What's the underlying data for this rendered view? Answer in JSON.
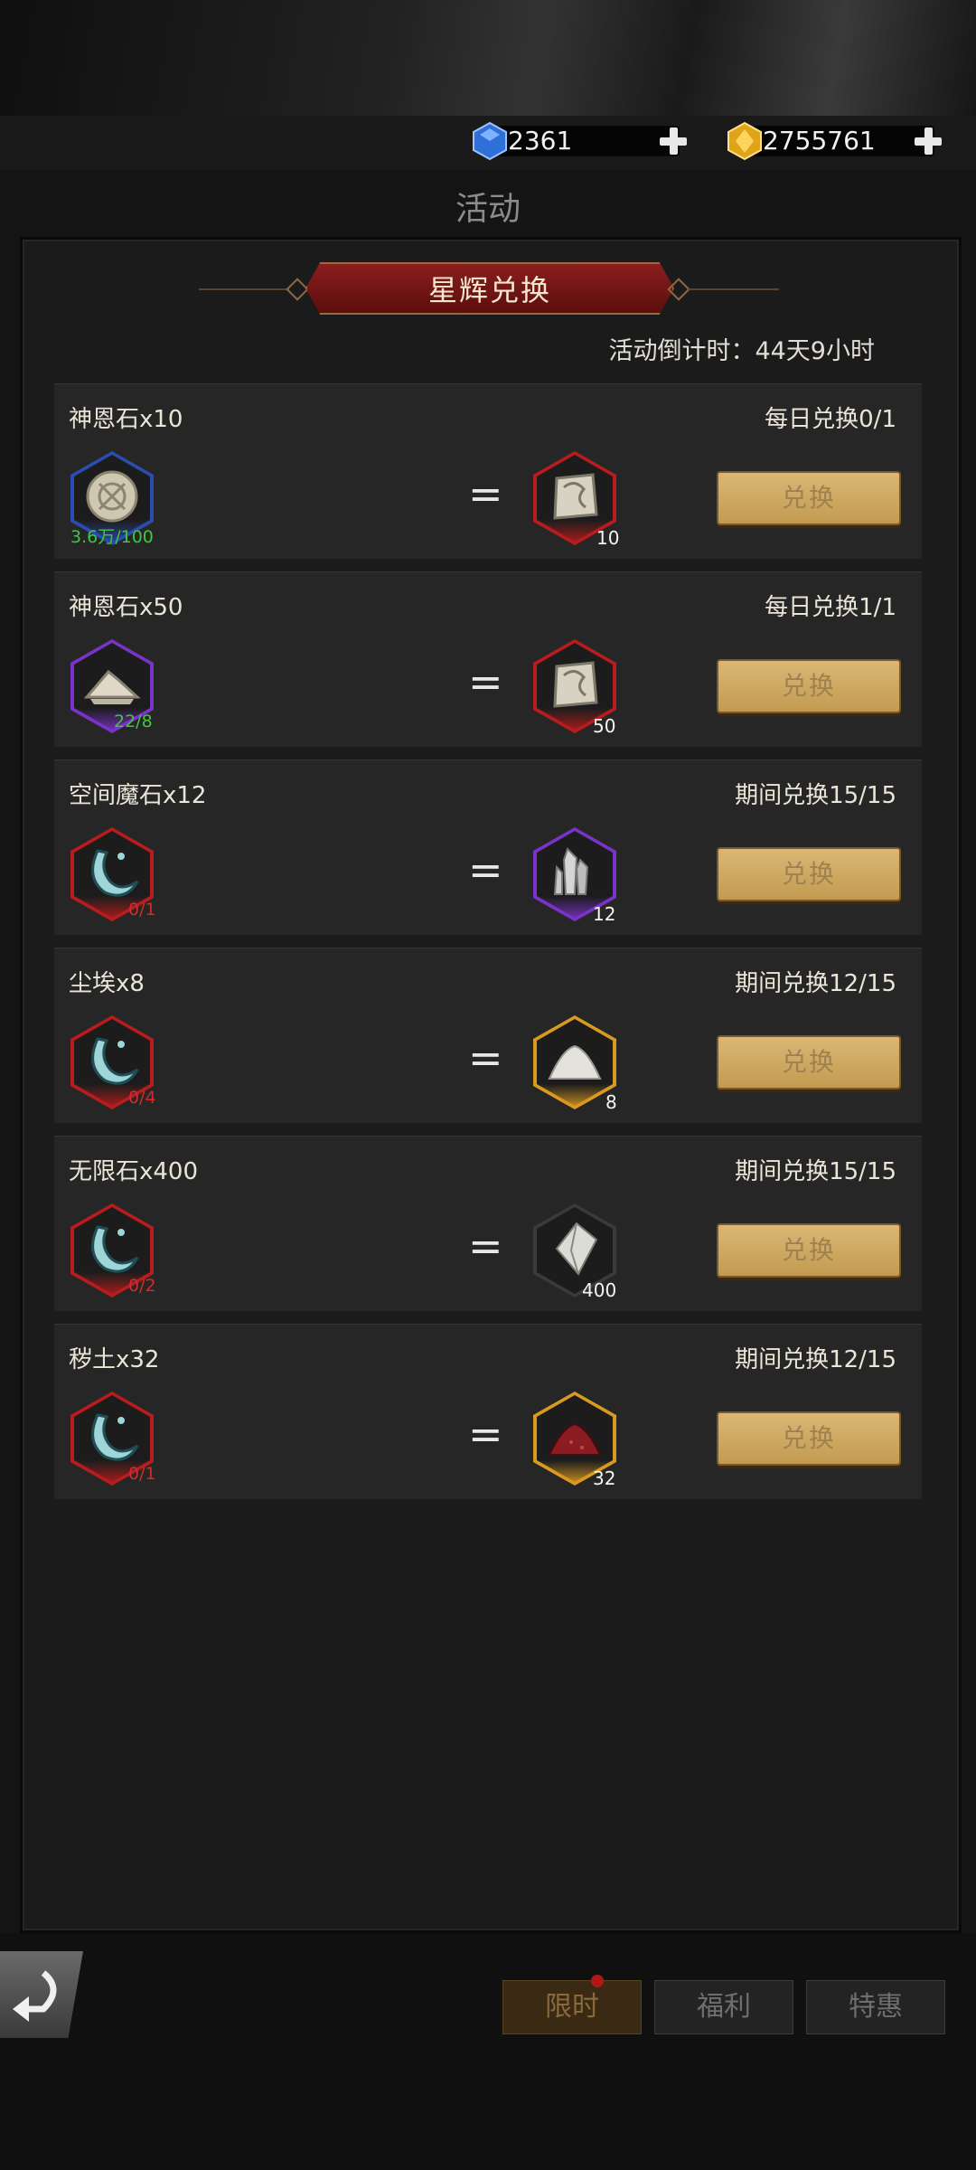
{
  "currency": [
    {
      "name": "diamond",
      "amount": "2361",
      "color": "#3d7de0"
    },
    {
      "name": "gold-gem",
      "amount": "2755761",
      "color": "#e8b020"
    }
  ],
  "header": {
    "title": "活动"
  },
  "banner": {
    "title": "星辉兑换"
  },
  "countdown": "活动倒计时：44天9小时",
  "exchanges": [
    {
      "name": "神恩石x10",
      "limit": "每日兑换0/1",
      "cost_count": "3.6万/100",
      "cost_count_color": "#3ec83e",
      "reward_count": "10",
      "button": "兑换"
    },
    {
      "name": "神恩石x50",
      "limit": "每日兑换1/1",
      "cost_count": "22/8",
      "cost_count_color": "#3ec83e",
      "reward_count": "50",
      "button": "兑换"
    },
    {
      "name": "空间魔石x12",
      "limit": "期间兑换15/15",
      "cost_count": "0/1",
      "cost_count_color": "#d42a2a",
      "reward_count": "12",
      "button": "兑换"
    },
    {
      "name": "尘埃x8",
      "limit": "期间兑换12/15",
      "cost_count": "0/4",
      "cost_count_color": "#d42a2a",
      "reward_count": "8",
      "button": "兑换"
    },
    {
      "name": "无限石x400",
      "limit": "期间兑换15/15",
      "cost_count": "0/2",
      "cost_count_color": "#d42a2a",
      "reward_count": "400",
      "button": "兑换"
    },
    {
      "name": "秽土x32",
      "limit": "期间兑换12/15",
      "cost_count": "0/1",
      "cost_count_color": "#d42a2a",
      "reward_count": "32",
      "button": "兑换"
    }
  ],
  "tabs": [
    {
      "label": "限时",
      "active": true
    },
    {
      "label": "福利",
      "active": false
    },
    {
      "label": "特惠",
      "active": false
    }
  ]
}
